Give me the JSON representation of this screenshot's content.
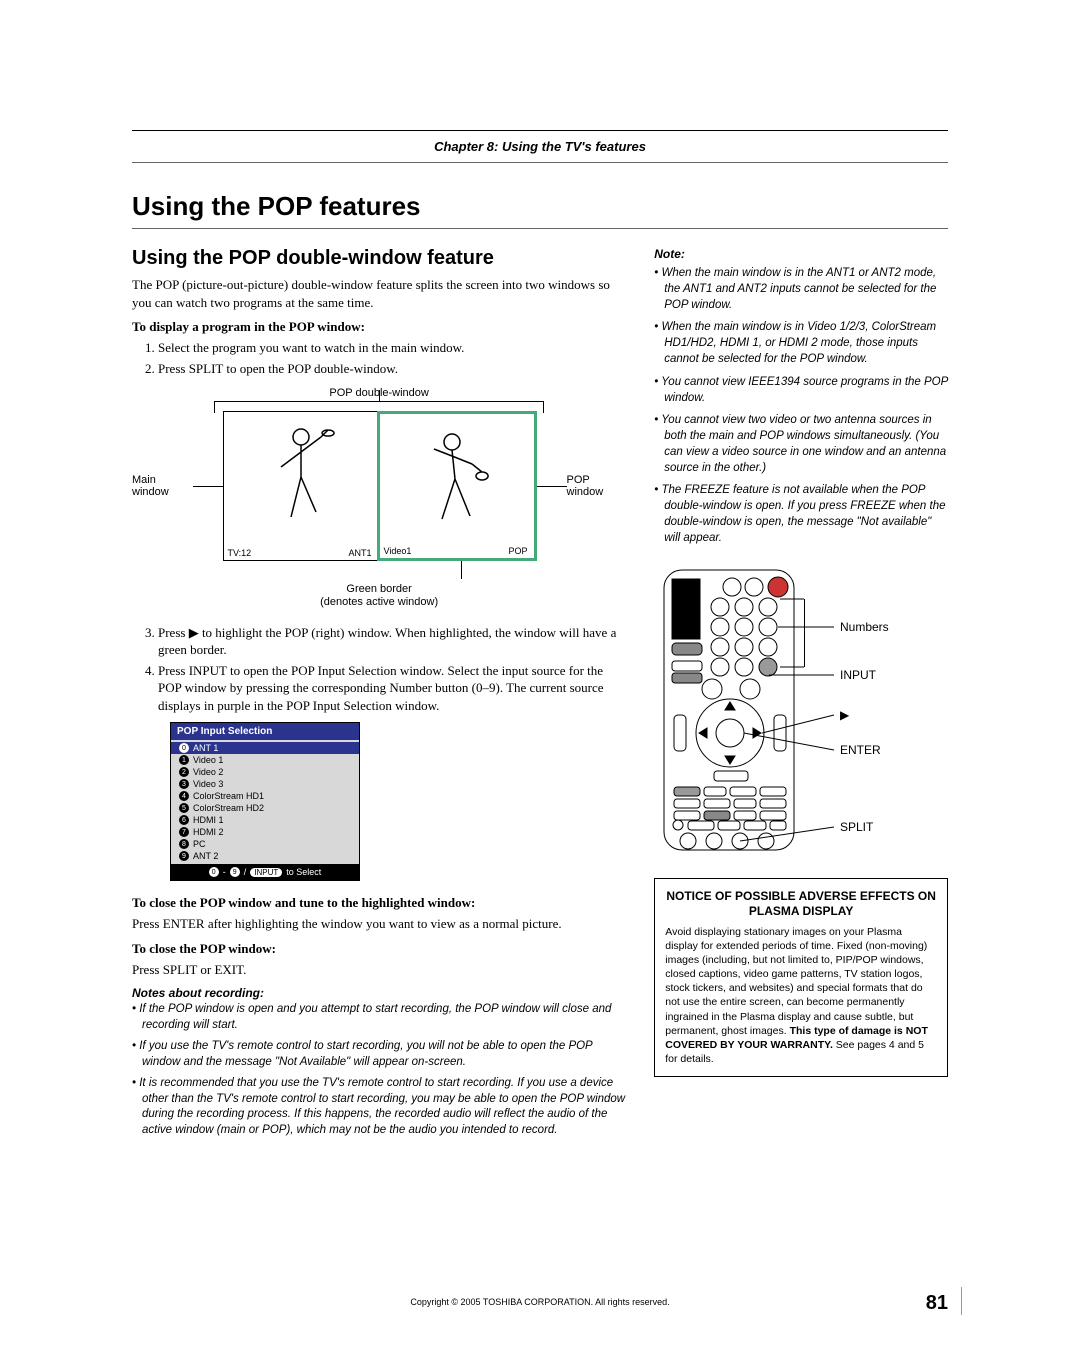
{
  "chapter_header": "Chapter 8: Using the TV's features",
  "page_title": "Using the POP features",
  "section_title": "Using the POP double-window feature",
  "intro": "The POP (picture-out-picture) double-window feature splits the screen into two windows so you can watch two programs at the same time.",
  "subhead_display": "To display a program in the POP window:",
  "steps_display": [
    "Select the program you want to watch in the main window.",
    "Press SPLIT to open the POP double-window."
  ],
  "diagram": {
    "top": "POP double-window",
    "main": "Main window",
    "pop": "POP window",
    "tvnum": "TV:12",
    "ant1": "ANT1",
    "video1": "Video1",
    "poplabel": "POP",
    "green1": "Green border",
    "green2": "(denotes active window)"
  },
  "step3": "Press ▶ to highlight the POP (right) window. When highlighted, the window will have a green border.",
  "step4": "Press INPUT to open the POP Input Selection window. Select the input source for the POP window by pressing the corresponding Number button (0–9). The current source displays in purple in the POP Input Selection window.",
  "pop_input": {
    "title": "POP Input Selection",
    "items": [
      {
        "n": "0",
        "label": "ANT 1"
      },
      {
        "n": "1",
        "label": "Video 1"
      },
      {
        "n": "2",
        "label": "Video 2"
      },
      {
        "n": "3",
        "label": "Video 3"
      },
      {
        "n": "4",
        "label": "ColorStream HD1"
      },
      {
        "n": "5",
        "label": "ColorStream HD2"
      },
      {
        "n": "6",
        "label": "HDMI 1"
      },
      {
        "n": "7",
        "label": "HDMI 2"
      },
      {
        "n": "8",
        "label": "PC"
      },
      {
        "n": "9",
        "label": "ANT 2"
      }
    ],
    "footer_a": "0",
    "footer_dash": " - ",
    "footer_b": "9",
    "footer_slash": " / ",
    "footer_pill": "INPUT",
    "footer_txt": " to Select"
  },
  "subhead_close_tune": "To close the POP window and tune to the highlighted window:",
  "close_tune_body": "Press ENTER after highlighting the window you want to view as a normal picture.",
  "subhead_close": "To close the POP window:",
  "close_body": "Press SPLIT or EXIT.",
  "notes_recording_head": "Notes about recording:",
  "notes_recording": [
    "If the POP window is open and you attempt to start recording, the POP window will close and recording will start.",
    "If you use the TV's remote control to start recording, you will not be able to open the POP window and the message \"Not Available\" will appear on-screen.",
    "It is recommended that you use the TV's remote control to start recording. If you use a device other than the TV's remote control to start recording, you may be able to open the POP window during the recording process. If this happens, the recorded audio will reflect the audio of the active window (main or POP), which may not be the audio you intended to record."
  ],
  "note_head": "Note:",
  "notes_side": [
    "When the main window is in the ANT1 or ANT2 mode, the ANT1 and ANT2 inputs cannot be selected for the POP window.",
    "When the main window is in Video 1/2/3, ColorStream HD1/HD2, HDMI 1, or HDMI 2 mode, those inputs cannot be selected for the POP window.",
    "You cannot view IEEE1394 source programs in the POP window.",
    "You cannot view two video or two antenna sources in both the main and POP windows simultaneously. (You can view a video source in one window and an antenna source in the other.)",
    "The FREEZE feature is not available when the POP double-window is open. If you press FREEZE when the double-window is open, the message \"Not available\" will appear."
  ],
  "callouts": {
    "numbers": "Numbers",
    "input": "INPUT",
    "play": "▶",
    "enter": "ENTER",
    "split": "SPLIT"
  },
  "warning": {
    "title": "NOTICE OF POSSIBLE ADVERSE EFFECTS ON PLASMA DISPLAY",
    "body_a": "Avoid displaying stationary images on your Plasma display for extended periods of time. Fixed (non-moving) images (including, but not limited to, PIP/POP windows, closed captions, video game patterns, TV station logos, stock tickers, and websites) and special formats that do not use the entire screen, can become permanently ingrained in the Plasma display and cause subtle, but permanent, ghost images. ",
    "body_bold": "This type of damage is NOT COVERED BY YOUR WARRANTY.",
    "body_b": "   See pages 4 and 5 for details."
  },
  "copyright": "Copyright © 2005 TOSHIBA CORPORATION. All rights reserved.",
  "page_number": "81"
}
